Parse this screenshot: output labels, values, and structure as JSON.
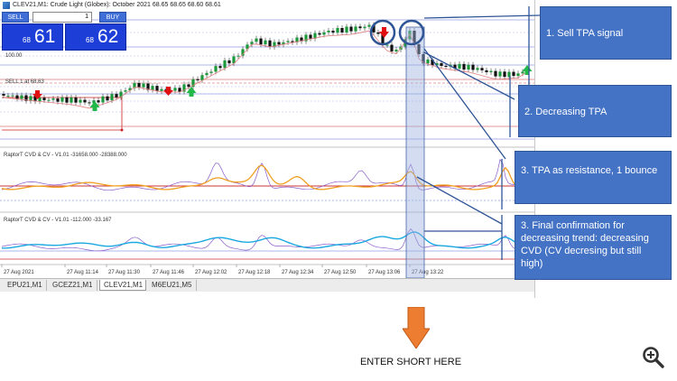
{
  "window": {
    "title": "CLEV21,M1:  Crude Light (Globex): October 2021  68.65 68.65 68.60 68.61"
  },
  "trade_panel": {
    "sell_label": "SELL",
    "buy_label": "BUY",
    "volume": "1",
    "sell_price_small": "68",
    "sell_price_big": "61",
    "buy_price_small": "68",
    "buy_price_big": "62"
  },
  "main_chart": {
    "level_label_1": "100.00",
    "order_label": "SELL 1 at 68.63"
  },
  "indicators": [
    {
      "label": "RaptorT CVD & CV - V1.01 -31658.000 -28388.000"
    },
    {
      "label": "RaptorT CVD & CV - V1.01 -112.000 -33.167"
    }
  ],
  "time_axis": [
    "27 Aug 2021",
    "27 Aug 11:14",
    "27 Aug 11:30",
    "27 Aug 11:46",
    "27 Aug 12:02",
    "27 Aug 12:18",
    "27 Aug 12:34",
    "27 Aug 12:50",
    "27 Aug 13:06",
    "27 Aug 13:22"
  ],
  "tabs": [
    {
      "label": "EPU21,M1",
      "active": false
    },
    {
      "label": "GCEZ21,M1",
      "active": false
    },
    {
      "label": "CLEV21,M1",
      "active": true
    },
    {
      "label": "M6EU21,M5",
      "active": false
    }
  ],
  "callouts": {
    "c1": "1. Sell TPA signal",
    "c2": "2. Decreasing TPA",
    "c3": "3. TPA as resistance, 1 bounce",
    "c4": "3. Final confirmation for decreasing  trend: decreasing CVD (CV decresing but still high)"
  },
  "enter_label": "ENTER SHORT HERE",
  "colors": {
    "callout": "#4472c4",
    "callout_connector": "#2f5597",
    "arrow": "#ed7d31",
    "price_box": "#1d3fd8",
    "cvd_orange": "#f0a020",
    "cvd_purple": "#8a5cc8",
    "cv_cyan": "#1aa8e0",
    "sell_arrow": "#e01010",
    "buy_arrow": "#22b84a"
  },
  "icons": {
    "zoom": "zoom-in-icon",
    "down_arrow": "down-arrow-icon"
  }
}
